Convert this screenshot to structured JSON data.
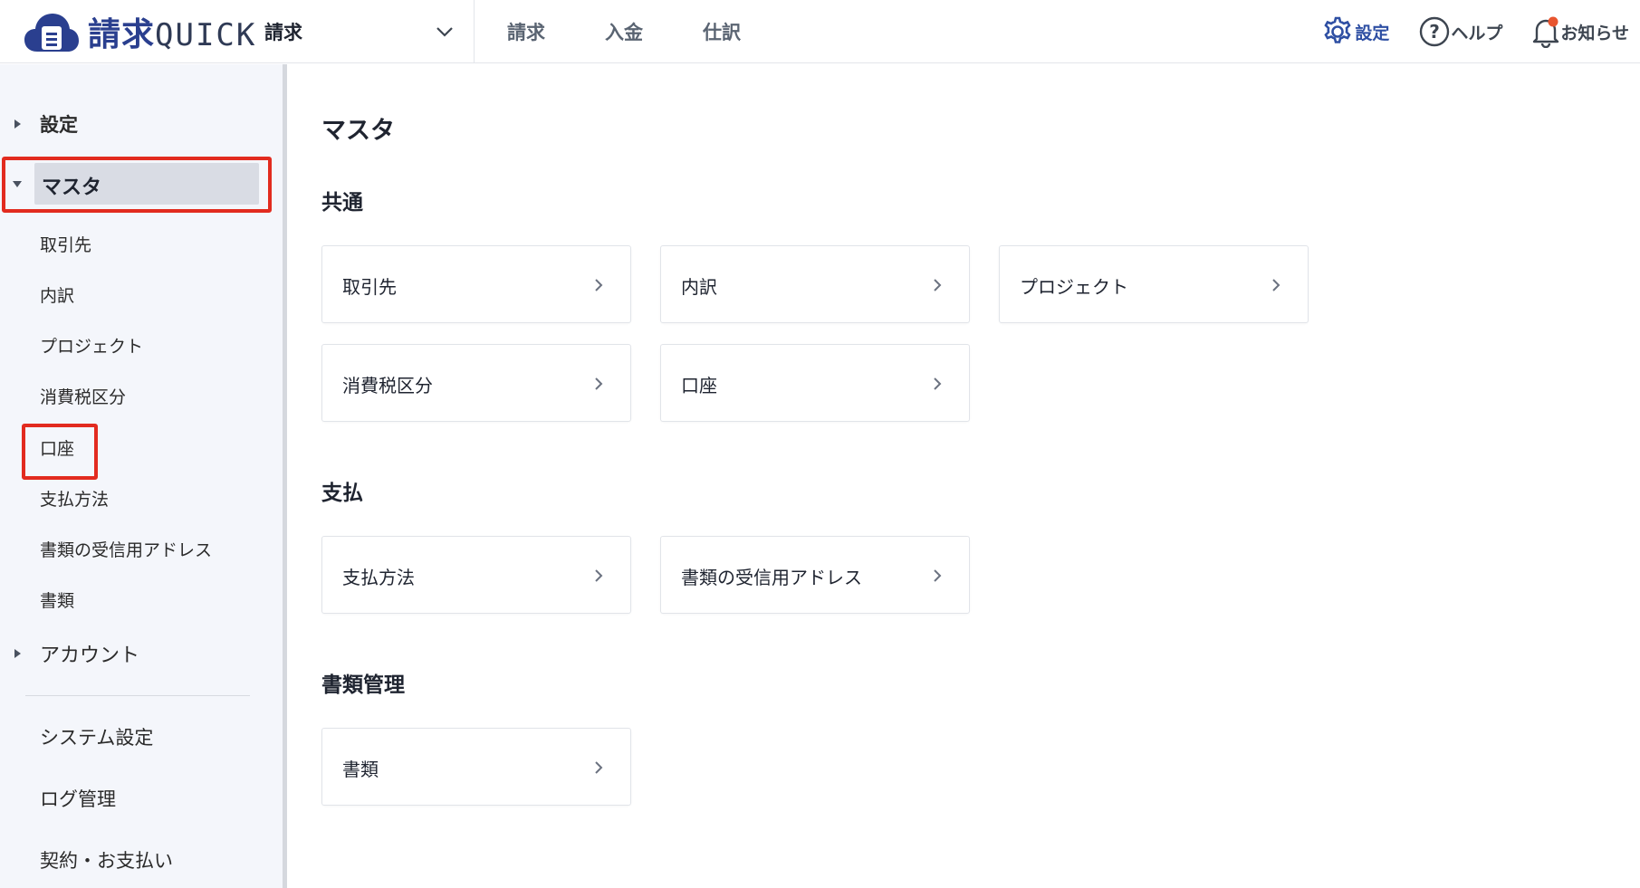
{
  "header": {
    "logo_text_a": "請求",
    "logo_text_b": "QUICK",
    "product": "請求",
    "nav": [
      "請求",
      "入金",
      "仕訳"
    ],
    "settings_label": "設定",
    "help_label": "ヘルプ",
    "notice_label": "お知らせ"
  },
  "sidebar": {
    "settings": "設定",
    "master": "マスタ",
    "master_items": [
      "取引先",
      "内訳",
      "プロジェクト",
      "消費税区分",
      "口座",
      "支払方法",
      "書類の受信用アドレス",
      "書類"
    ],
    "account": "アカウント",
    "system_items": [
      "システム設定",
      "ログ管理",
      "契約・お支払い"
    ]
  },
  "main": {
    "title": "マスタ",
    "sections": [
      {
        "title": "共通",
        "cards": [
          "取引先",
          "内訳",
          "プロジェクト",
          "消費税区分",
          "口座"
        ]
      },
      {
        "title": "支払",
        "cards": [
          "支払方法",
          "書類の受信用アドレス"
        ]
      },
      {
        "title": "書類管理",
        "cards": [
          "書類"
        ]
      }
    ]
  },
  "colors": {
    "brand": "#2a3f8f",
    "accent_blue": "#2e4fa3",
    "highlight_red": "#e22b1f",
    "notice_dot": "#e8552f",
    "sidebar_bg": "#f4f6fb",
    "selected_bg": "#d9dce4"
  }
}
